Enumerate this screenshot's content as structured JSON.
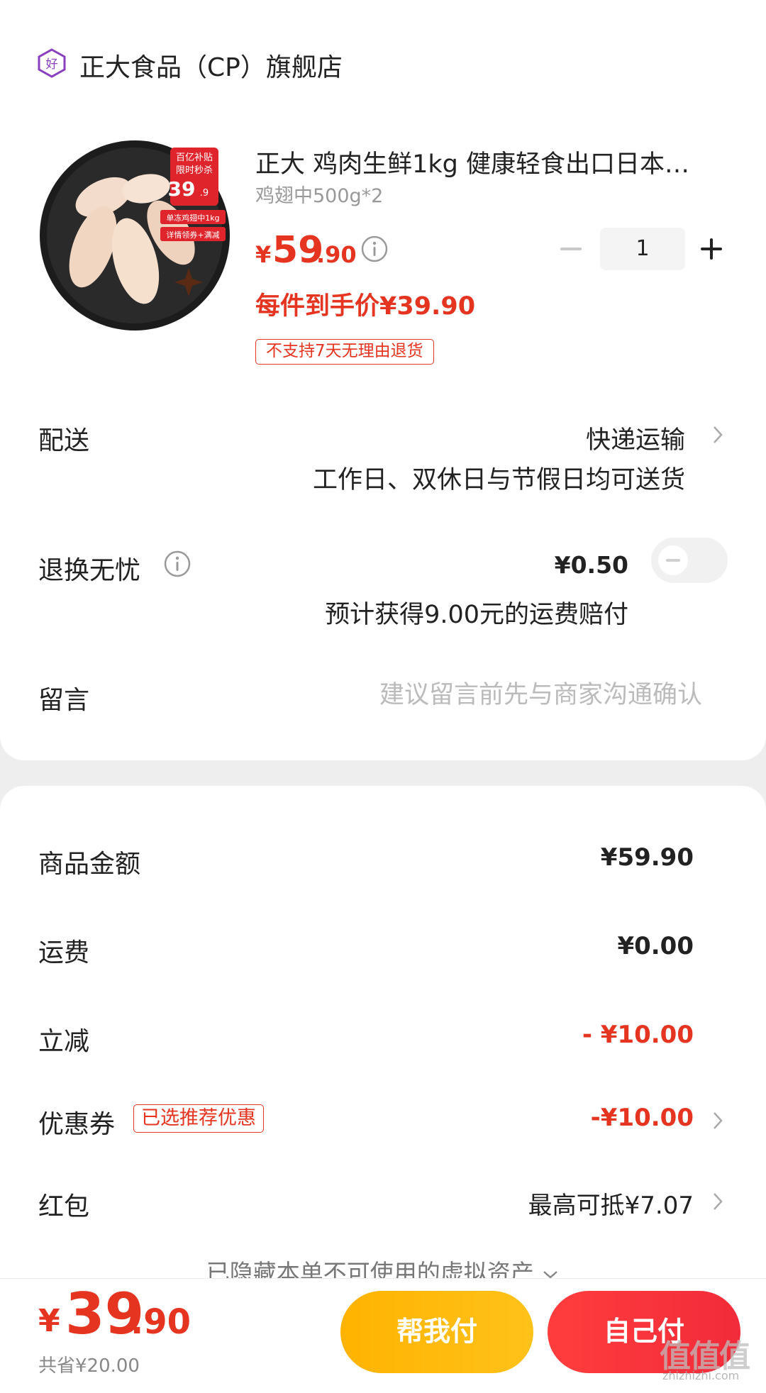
{
  "shop": {
    "name": "正大食品（CP）旗舰店",
    "icon": "good-store-icon"
  },
  "product": {
    "title": "正大 鸡肉生鲜1kg 健康轻食出口日本…",
    "spec": "鸡翅中500g*2",
    "price_symbol": "¥",
    "price_int": "59",
    "price_dec": ".90",
    "per_item_price": "每件到手价¥39.90",
    "no_return_tag": "不支持7天无理由退货",
    "image_badge_line1": "百亿补贴",
    "image_badge_line2": "限时秒杀",
    "image_badge_price": "39",
    "image_badge_price_dec": ".9",
    "image_tag1": "单冻鸡翅中1kg",
    "image_tag2": "详情领券+满减",
    "quantity": "1"
  },
  "delivery": {
    "label": "配送",
    "method": "快递运输",
    "note": "工作日、双休日与节假日均可送货"
  },
  "worry_free": {
    "label": "退换无忧",
    "price": "¥0.50",
    "note": "预计获得9.00元的运费赔付",
    "enabled": false
  },
  "message": {
    "label": "留言",
    "placeholder": "建议留言前先与商家沟通确认"
  },
  "summary": {
    "goods_label": "商品金额",
    "goods_value": "¥59.90",
    "shipping_label": "运费",
    "shipping_value": "¥0.00",
    "discount_label": "立减",
    "discount_value": "- ¥10.00",
    "coupon_label": "优惠券",
    "coupon_badge": "已选推荐优惠",
    "coupon_value": "-¥10.00",
    "redpacket_label": "红包",
    "redpacket_value": "最高可抵¥7.07",
    "hidden_assets": "已隐藏本单不可使用的虚拟资产"
  },
  "footer": {
    "total_symbol": "¥",
    "total_int": "39",
    "total_dec": ".90",
    "saved": "共省¥20.00",
    "help_pay": "帮我付",
    "self_pay": "自己付"
  },
  "watermark": {
    "text": "值值值",
    "sub": "zhizhizhi.com"
  },
  "colors": {
    "accent": "#e5341f",
    "help_button": "#ffb300",
    "pay_button": "#f22b3a"
  }
}
